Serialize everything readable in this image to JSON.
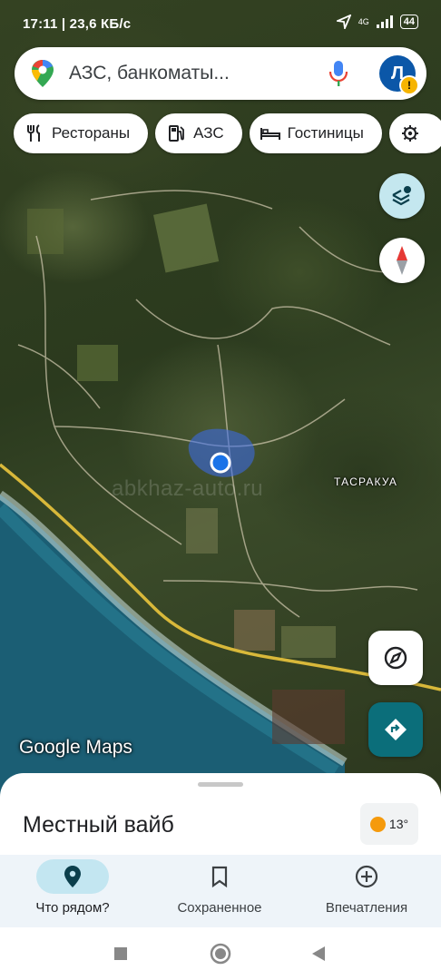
{
  "status_bar": {
    "time_speed": "17:11 | 23,6 КБ/с",
    "network_label": "4G",
    "battery": "44"
  },
  "search": {
    "placeholder": "АЗС, банкоматы...",
    "avatar_letter": "Л"
  },
  "chips": [
    {
      "label": "Рестораны",
      "icon": "fork-knife-icon"
    },
    {
      "label": "АЗС",
      "icon": "gas-station-icon"
    },
    {
      "label": "Гостиницы",
      "icon": "bed-icon"
    },
    {
      "label": "",
      "icon": "gear-icon"
    }
  ],
  "map": {
    "place_label": "ТАСРАКУА",
    "watermark": "abkhaz-auto.ru",
    "logo": "Google Maps",
    "colors": {
      "sea": "#1b5e74",
      "road": "#d8b83a",
      "location_dot": "#1a73e8"
    }
  },
  "sheet": {
    "title": "Местный вайб",
    "temperature": "13°"
  },
  "nav": [
    {
      "label": "Что рядом?",
      "icon": "map-pin-icon",
      "active": true
    },
    {
      "label": "Сохраненное",
      "icon": "bookmark-icon",
      "active": false
    },
    {
      "label": "Впечатления",
      "icon": "plus-circle-icon",
      "active": false
    }
  ]
}
